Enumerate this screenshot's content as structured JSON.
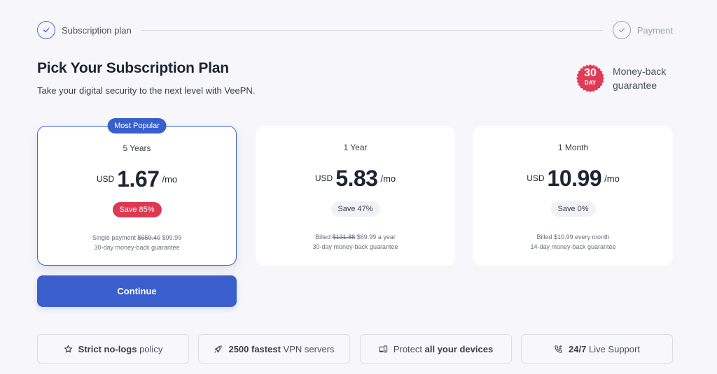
{
  "stepper": {
    "steps": [
      {
        "label": "Subscription plan",
        "state": "active"
      },
      {
        "label": "Payment",
        "state": "inactive"
      }
    ]
  },
  "header": {
    "title": "Pick Your Subscription Plan",
    "subtitle": "Take your digital security to the next level with VeePN."
  },
  "guarantee": {
    "badge_number": "30",
    "badge_unit": "DAY",
    "text": "Money-back guarantee",
    "badge_color": "#e03a55"
  },
  "plans": [
    {
      "name": "5 Years",
      "currency": "USD",
      "amount": "1.67",
      "period": "/mo",
      "save": "Save 85%",
      "badge": "Most Popular",
      "selected": true,
      "billing_prefix": "Single payment",
      "billing_old": "$659.40",
      "billing_new": "$99.99",
      "billing_suffix": "",
      "guarantee": "30-day money-back guarantee"
    },
    {
      "name": "1 Year",
      "currency": "USD",
      "amount": "5.83",
      "period": "/mo",
      "save": "Save 47%",
      "selected": false,
      "billing_prefix": "Billed",
      "billing_old": "$131.88",
      "billing_new": "$69.99",
      "billing_suffix": "a year",
      "guarantee": "30-day money-back guarantee"
    },
    {
      "name": "1 Month",
      "currency": "USD",
      "amount": "10.99",
      "period": "/mo",
      "save": "Save 0%",
      "selected": false,
      "billing_text": "Billed $10.99 every month",
      "guarantee": "14-day money-back guarantee"
    }
  ],
  "actions": {
    "continue_label": "Continue"
  },
  "features": [
    {
      "icon": "star-icon",
      "bold": "Strict no-logs",
      "text": "policy",
      "bold_first": true
    },
    {
      "icon": "rocket-icon",
      "bold": "2500 fastest",
      "text": "VPN servers",
      "bold_first": true
    },
    {
      "icon": "devices-icon",
      "text": "Protect",
      "bold": "all your devices",
      "bold_first": false
    },
    {
      "icon": "phone-support-icon",
      "bold": "24/7",
      "text": "Live Support",
      "bold_first": true
    }
  ],
  "colors": {
    "accent": "#3a5fcd",
    "save_hot": "#dc3a52",
    "background": "#f6f6fb"
  }
}
